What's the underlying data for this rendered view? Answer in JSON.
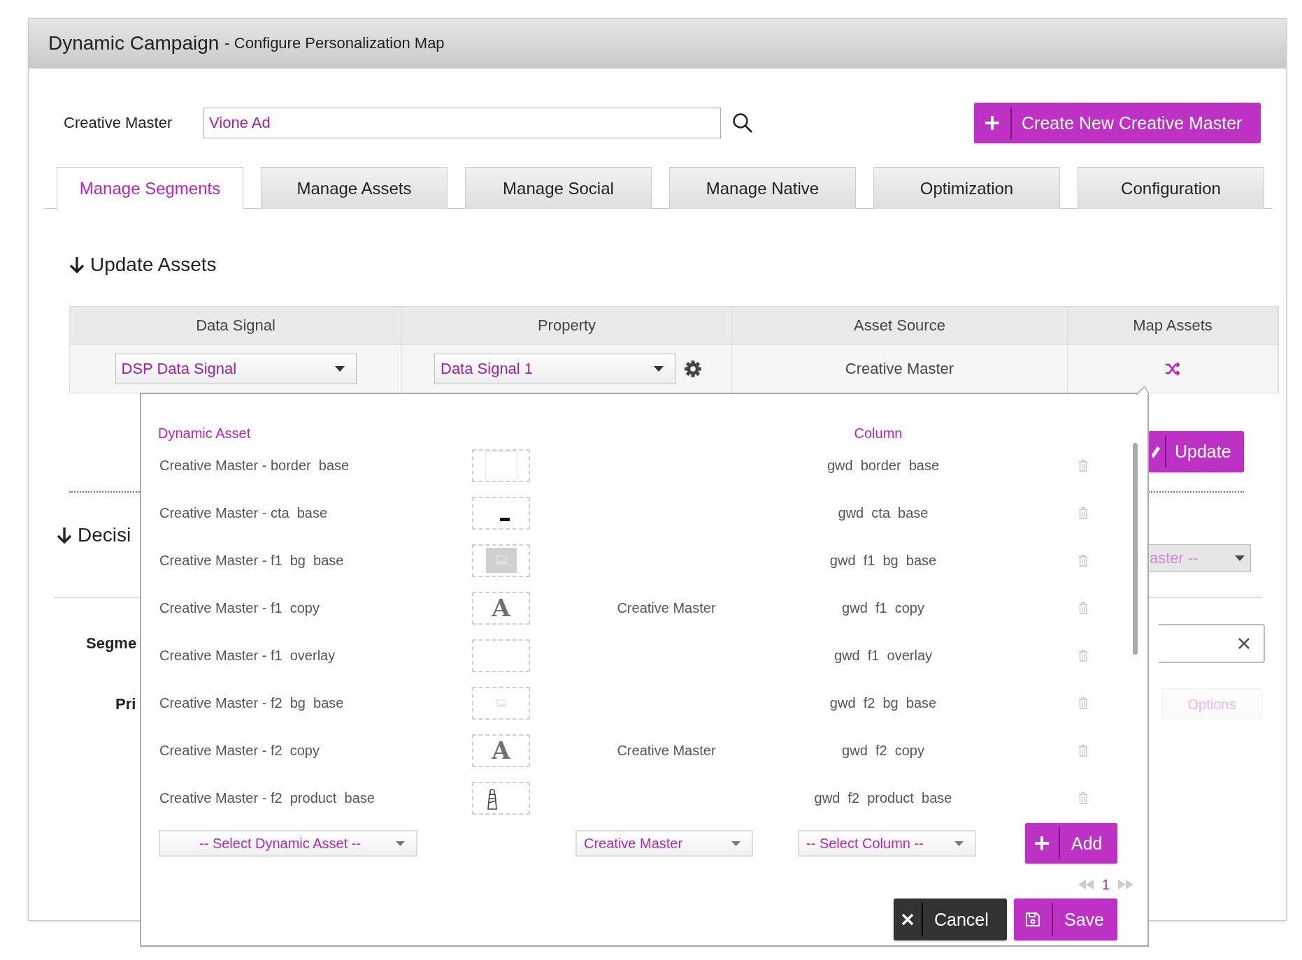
{
  "header": {
    "title": "Dynamic Campaign",
    "subtitle": "- Configure Personalization Map"
  },
  "creative_master": {
    "label": "Creative Master",
    "value": "Vione Ad"
  },
  "create_button": "Create New Creative Master",
  "tabs": [
    {
      "label": "Manage Segments",
      "selected": true
    },
    {
      "label": "Manage Assets",
      "selected": false
    },
    {
      "label": "Manage Social",
      "selected": false
    },
    {
      "label": "Manage Native",
      "selected": false
    },
    {
      "label": "Optimization",
      "selected": false
    },
    {
      "label": "Configuration",
      "selected": false
    }
  ],
  "update_assets": {
    "heading": "Update Assets",
    "columns": [
      "Data Signal",
      "Property",
      "Asset Source",
      "Map Assets"
    ],
    "row": {
      "data_signal": "DSP Data Signal",
      "property": "Data Signal 1",
      "asset_source": "Creative Master"
    }
  },
  "update_button": "Update",
  "background": {
    "decision_heading": "Decisi",
    "default_master_select": "aster --",
    "segments_label": "Segme",
    "priority_label": "Pri",
    "options_button": "Options"
  },
  "popup": {
    "columns": [
      "Dynamic Asset",
      "Column"
    ],
    "rows": [
      {
        "asset": "Creative Master - border  base",
        "kind": "frame",
        "column": "gwd  border  base"
      },
      {
        "asset": "Creative Master - cta  base",
        "kind": "cta",
        "column": "gwd  cta  base"
      },
      {
        "asset": "Creative Master - f1  bg  base",
        "kind": "image",
        "column": "gwd  f1  bg  base"
      },
      {
        "asset": "Creative Master - f1  copy",
        "kind": "text",
        "glyph": "A",
        "source": "Creative Master",
        "column": "gwd  f1  copy"
      },
      {
        "asset": "Creative Master - f1  overlay",
        "kind": "empty",
        "column": "gwd  f1  overlay"
      },
      {
        "asset": "Creative Master - f2  bg  base",
        "kind": "image_faint",
        "column": "gwd  f2  bg  base"
      },
      {
        "asset": "Creative Master - f2  copy",
        "kind": "text",
        "glyph": "A",
        "source": "Creative Master",
        "column": "gwd  f2  copy"
      },
      {
        "asset": "Creative Master - f2  product  base",
        "kind": "lighthouse",
        "column": "gwd  f2  product  base"
      }
    ],
    "asset_select": "-- Select Dynamic Asset --",
    "source_select": "Creative Master",
    "column_select": "-- Select Column --",
    "add_button": "Add",
    "page": "1",
    "cancel_button": "Cancel",
    "save_button": "Save"
  }
}
